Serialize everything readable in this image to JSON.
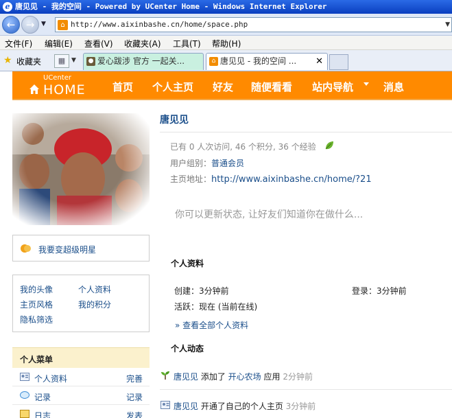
{
  "window": {
    "title": "唐见见 - 我的空间 - Powered by UCenter Home - Windows Internet Explorer"
  },
  "address": {
    "url": "http://www.aixinbashe.cn/home/space.php"
  },
  "menubar": {
    "items": [
      "文件(F)",
      "编辑(E)",
      "查看(V)",
      "收藏夹(A)",
      "工具(T)",
      "帮助(H)"
    ]
  },
  "favorites": {
    "label": "收藏夹"
  },
  "tabs": [
    {
      "label": "爱心跋涉 官方 一起关..."
    },
    {
      "label": "唐见见 - 我的空间 ..."
    }
  ],
  "site_nav": {
    "logo_top": "UCenter",
    "logo_main": "HOME",
    "links": [
      "首页",
      "个人主页",
      "好友",
      "随便看看",
      "站内导航",
      "消息"
    ]
  },
  "sidebar": {
    "star_link": "我要变超级明星",
    "quick_links": [
      "我的头像",
      "个人资料",
      "主页风格",
      "我的积分",
      "隐私筛选"
    ],
    "menu_title": "个人菜单",
    "menu_items": [
      {
        "label": "个人资料",
        "action": "完善"
      },
      {
        "label": "记录",
        "action": "记录"
      },
      {
        "label": "日志",
        "action": "发表"
      }
    ]
  },
  "profile": {
    "name": "唐见见",
    "stats": "已有 0 人次访问, 46 个积分, 36 个经验",
    "group_label": "用户组别：",
    "group_value": "普通会员",
    "homepage_label": "主页地址：",
    "homepage_value": "http://www.aixinbashe.cn/home/?21",
    "status_prompt": "你可以更新状态, 让好友们知道你在做什么...",
    "section_info": "个人资料",
    "created": "创建：3分钟前",
    "login": "登录：3分钟前",
    "active": "活跃：现在 (当前在线)",
    "view_all": "» 查看全部个人资料",
    "section_feed": "个人动态"
  },
  "feed": [
    {
      "user": "唐见见",
      "pre": " 添加了 ",
      "app": "开心农场",
      "post": " 应用 ",
      "time": "2分钟前"
    },
    {
      "user": "唐见见",
      "pre": " 开通了自己的个人主页 ",
      "app": "",
      "post": "",
      "time": "3分钟前"
    }
  ],
  "colors": {
    "accent": "#ff8a00",
    "link": "#1a4e8a",
    "menu_header_bg": "#fbf1cd"
  }
}
